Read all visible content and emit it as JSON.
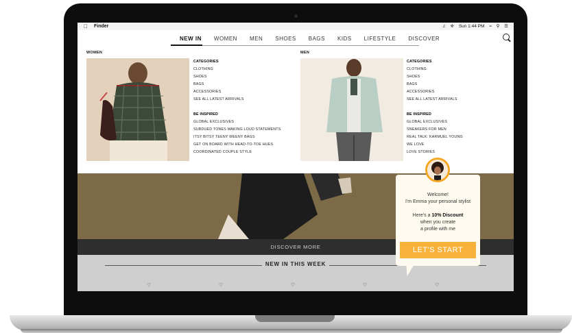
{
  "menubar": {
    "app_name": "Finder",
    "clock": "Sun 1:44 PM"
  },
  "nav": {
    "items": [
      {
        "label": "NEW IN"
      },
      {
        "label": "WOMEN"
      },
      {
        "label": "MEN"
      },
      {
        "label": "SHOES"
      },
      {
        "label": "BAGS"
      },
      {
        "label": "KIDS"
      },
      {
        "label": "LIFESTYLE"
      },
      {
        "label": "DISCOVER"
      }
    ],
    "active": "NEW IN"
  },
  "women": {
    "section_label": "WOMEN",
    "categories_heading": "CATEGORIES",
    "categories": [
      "CLOTHING",
      "SHOES",
      "BAGS",
      "ACCESSORIES",
      "SEE ALL LATEST ARRIVALS"
    ],
    "inspired_heading": "BE INSPIRED",
    "inspired": [
      "GLOBAL EXCLUSIVES",
      "SUBDUED TONES MAKING LOUD STATEMENTS",
      "ITSY BITSY TEENY WEENY BAGS",
      "GET ON BOARD WITH HEAD-TO-TOE HUES",
      "COORDINATED COUPLE STYLE"
    ]
  },
  "men": {
    "section_label": "MEN",
    "categories_heading": "CATEGORIES",
    "categories": [
      "CLOTHING",
      "SHOES",
      "BAGS",
      "ACCESSORIES",
      "SEE ALL LATEST ARRIVALS"
    ],
    "inspired_heading": "BE INSPIRED",
    "inspired": [
      "GLOBAL EXCLUSIVES",
      "SNEAKERS FOR MEN",
      "REAL TALK: KARMUEL YOUNG",
      "WE LOVE",
      "LOVE STORIES"
    ]
  },
  "discover_more": "DISCOVER MORE",
  "new_this_week": "NEW IN THIS WEEK",
  "chat": {
    "welcome": "Welcome!",
    "intro": "I'm Emma your personal stylist",
    "offer_prefix": "Here's a",
    "offer_bold": "10% Discount",
    "offer_line2": "when you create",
    "offer_line3": "a profile with me",
    "button": "LET'S START"
  },
  "colors": {
    "accent": "#f8b23c",
    "hero": "#7f6e4d",
    "discover_bar": "#2e2e2e"
  }
}
